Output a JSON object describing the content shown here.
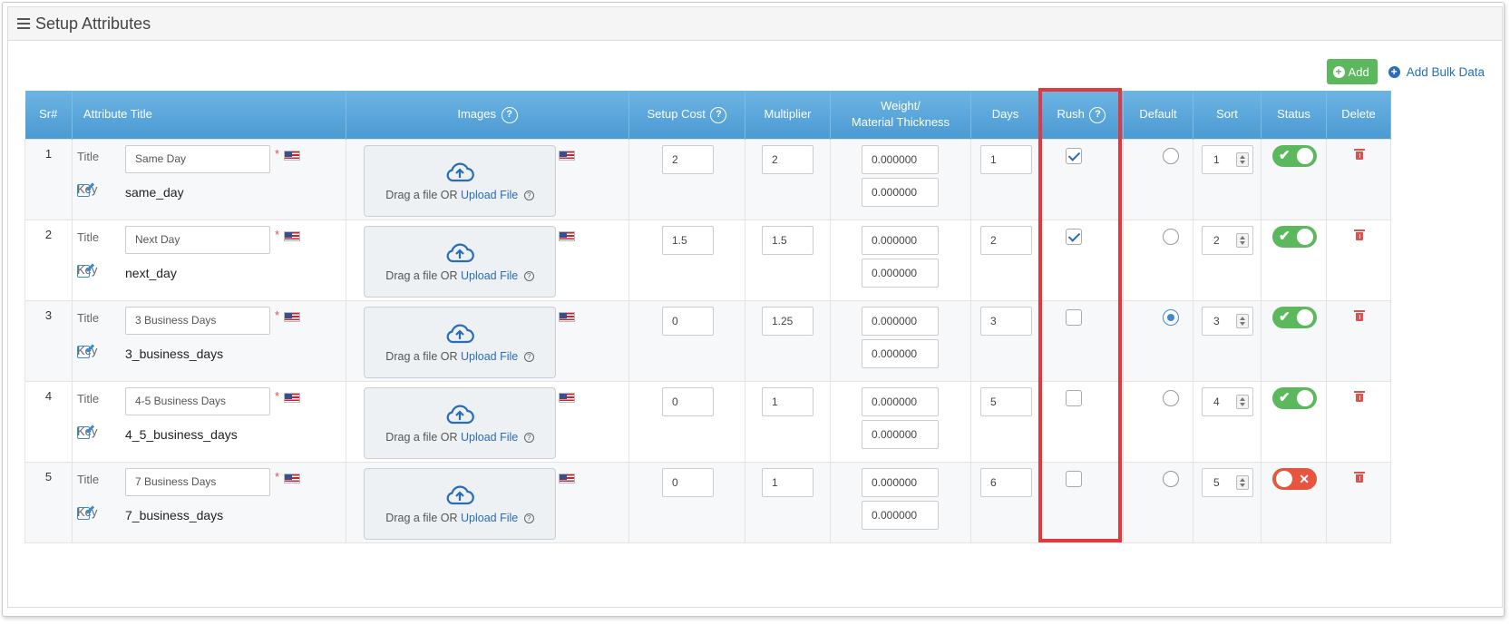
{
  "panel": {
    "title": "Setup Attributes"
  },
  "toolbar": {
    "add_label": "Add",
    "bulk_label": "Add Bulk Data"
  },
  "colors": {
    "header": "#4b9ad3",
    "add_button": "#5cb85c",
    "highlight": "#e0393e",
    "status_on": "#5cb85c",
    "status_off": "#e8553e"
  },
  "table": {
    "headers": {
      "sr": "Sr#",
      "title": "Attribute Title",
      "images": "Images",
      "setup_cost": "Setup Cost",
      "multiplier": "Multiplier",
      "weight_line1": "Weight/",
      "weight_line2": "Material Thickness",
      "days": "Days",
      "rush": "Rush",
      "default": "Default",
      "sort": "Sort",
      "status": "Status",
      "delete": "Delete"
    },
    "title_label": "Title",
    "key_label": "Key",
    "required_mark": "*",
    "drop_text": "Drag a file OR",
    "upload_link": "Upload File",
    "help_mark": "?",
    "rows": [
      {
        "sr": "1",
        "title": "Same Day",
        "key": "same_day",
        "setup_cost": "2",
        "multiplier": "2",
        "weight": "0.000000",
        "thickness": "0.000000",
        "days": "1",
        "rush": true,
        "default": false,
        "sort": "1",
        "status": true
      },
      {
        "sr": "2",
        "title": "Next Day",
        "key": "next_day",
        "setup_cost": "1.5",
        "multiplier": "1.5",
        "weight": "0.000000",
        "thickness": "0.000000",
        "days": "2",
        "rush": true,
        "default": false,
        "sort": "2",
        "status": true
      },
      {
        "sr": "3",
        "title": "3 Business Days",
        "key": "3_business_days",
        "setup_cost": "0",
        "multiplier": "1.25",
        "weight": "0.000000",
        "thickness": "0.000000",
        "days": "3",
        "rush": false,
        "default": true,
        "sort": "3",
        "status": true
      },
      {
        "sr": "4",
        "title": "4-5 Business Days",
        "key": "4_5_business_days",
        "setup_cost": "0",
        "multiplier": "1",
        "weight": "0.000000",
        "thickness": "0.000000",
        "days": "5",
        "rush": false,
        "default": false,
        "sort": "4",
        "status": true
      },
      {
        "sr": "5",
        "title": "7 Business Days",
        "key": "7_business_days",
        "setup_cost": "0",
        "multiplier": "1",
        "weight": "0.000000",
        "thickness": "0.000000",
        "days": "6",
        "rush": false,
        "default": false,
        "sort": "5",
        "status": false
      }
    ]
  }
}
